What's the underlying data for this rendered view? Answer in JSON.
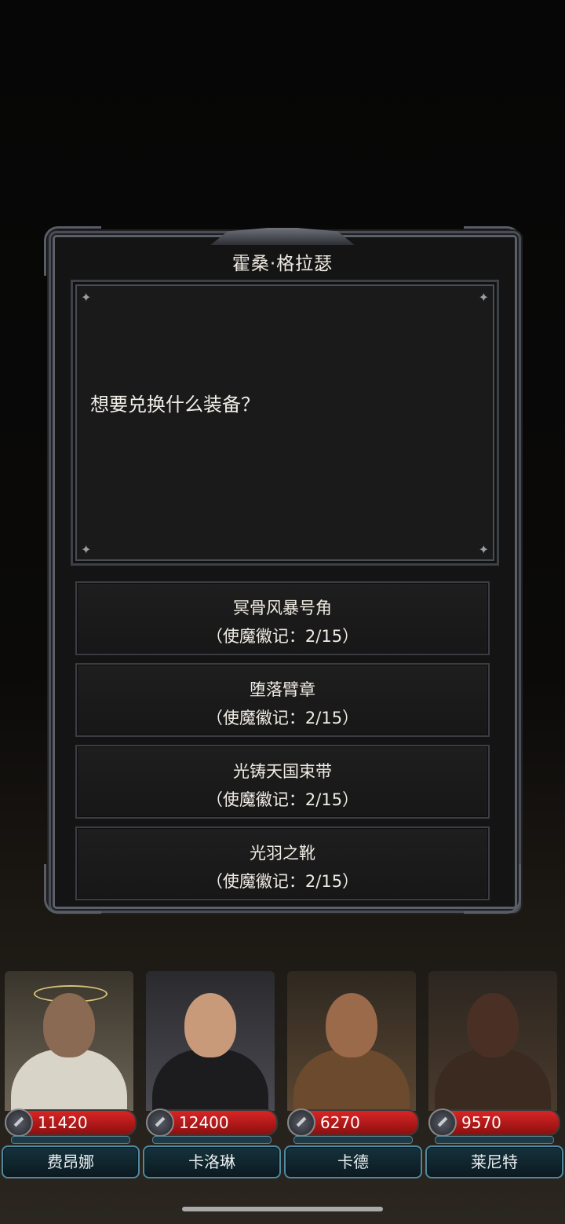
{
  "dialog": {
    "title": "霍桑·格拉瑟",
    "message": "想要兑换什么装备？"
  },
  "options": [
    {
      "name": "冥骨风暴号角",
      "cost": "（使魔徽记：2/15）"
    },
    {
      "name": "堕落臂章",
      "cost": "（使魔徽记：2/15）"
    },
    {
      "name": "光铸天国束带",
      "cost": "（使魔徽记：2/15）"
    },
    {
      "name": "光羽之靴",
      "cost": "（使魔徽记：2/15）"
    }
  ],
  "party": [
    {
      "name": "费昂娜",
      "hp": "11420"
    },
    {
      "name": "卡洛琳",
      "hp": "12400"
    },
    {
      "name": "卡德",
      "hp": "6270"
    },
    {
      "name": "莱尼特",
      "hp": "9570"
    }
  ],
  "colors": {
    "hp_bar": "#d92525",
    "name_button_border": "#4f8aa0"
  },
  "icons": {
    "hp": "sword-badge-icon",
    "dialog_corners": "sparkle-icon"
  }
}
